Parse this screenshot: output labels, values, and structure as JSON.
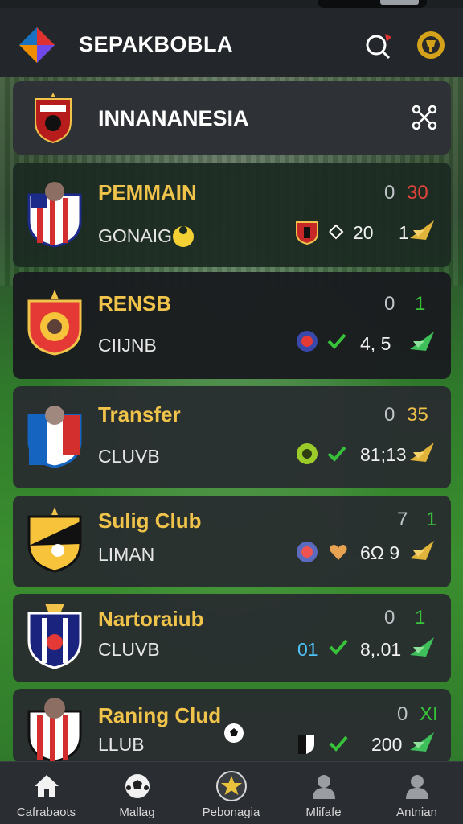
{
  "app": {
    "title": "SEPAKBOBLA"
  },
  "league": {
    "name": "INNANANESIA"
  },
  "cards": [
    {
      "title": "PEMMAIN",
      "subtitle": "GONAIG",
      "score_left": "0",
      "score_right": "30",
      "score_right_color": "#e0443a",
      "stat_value": "20",
      "stat_extra": "1"
    },
    {
      "title": "RENSB",
      "subtitle": "CIIJNB",
      "score_left": "0",
      "score_right": "1",
      "score_right_color": "#38c23a",
      "stat_value": "4, 5"
    },
    {
      "title": "Transfer",
      "subtitle": "CLUVB",
      "score_left": "0",
      "score_right": "35",
      "score_right_color": "#f0c34a",
      "stat_value": "81;13"
    },
    {
      "title": "Sulig Club",
      "subtitle": "LIMAN",
      "score_left": "7",
      "score_right": "1",
      "score_right_color": "#38c23a",
      "stat_value": "6Ω 9"
    },
    {
      "title": "Nartoraiub",
      "subtitle": "CLUVB",
      "score_left": "0",
      "score_right": "1",
      "score_right_color": "#38c23a",
      "stat_prefix": "01",
      "stat_value": "8,.01"
    },
    {
      "title": "Raning Clud",
      "subtitle": "LLUB",
      "score_left": "0",
      "score_right": "XI",
      "score_right_color": "#38c23a",
      "stat_value": "200"
    }
  ],
  "nav": {
    "items": [
      {
        "label": "Cafrabaots",
        "icon": "home-icon"
      },
      {
        "label": "Mallag",
        "icon": "soccer-ball-icon"
      },
      {
        "label": "Pebonagia",
        "icon": "star-badge-icon"
      },
      {
        "label": "Mlifafe",
        "icon": "user-icon"
      },
      {
        "label": "Antnian",
        "icon": "profile-icon"
      }
    ]
  },
  "colors": {
    "accent_gold": "#f0c34a",
    "positive_green": "#38c23a",
    "negative_red": "#e0443a",
    "header_bg": "#23272b"
  }
}
